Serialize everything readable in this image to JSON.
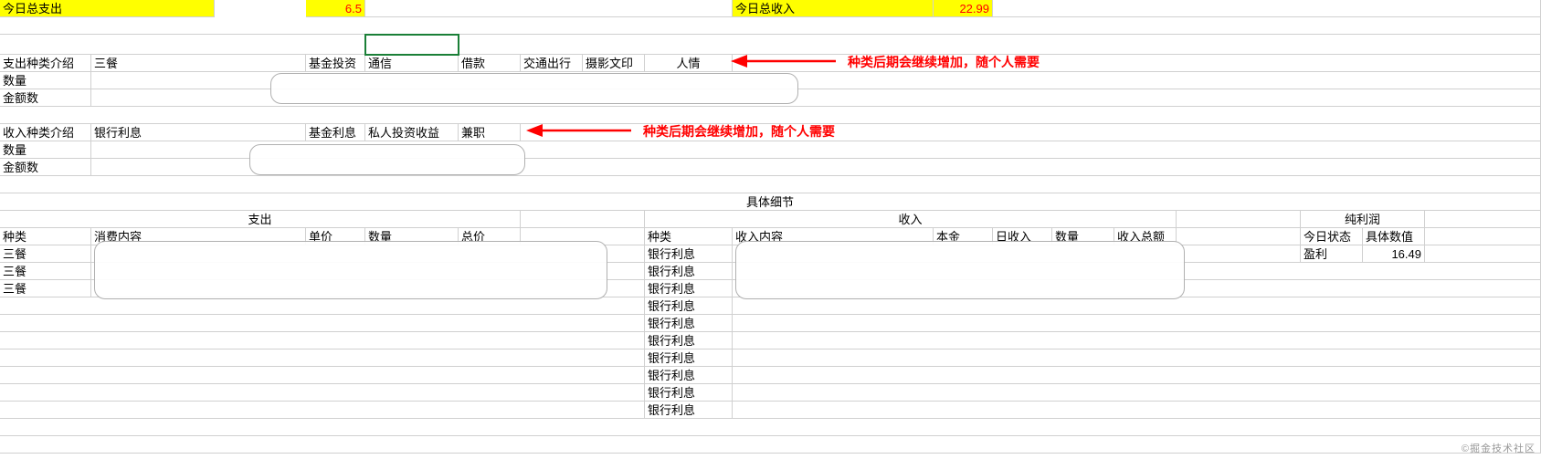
{
  "summary": {
    "expense_label": "今日总支出",
    "expense_value": "6.5",
    "income_label": "今日总收入",
    "income_value": "22.99"
  },
  "expense_category": {
    "row_label": "支出种类介绍",
    "items": [
      "三餐",
      "基金投资",
      "通信",
      "借款",
      "交通出行",
      "摄影文印",
      "人情"
    ],
    "qty_label": "数量",
    "amount_label": "金额数"
  },
  "income_category": {
    "row_label": "收入种类介绍",
    "items": [
      "银行利息",
      "基金利息",
      "私人投资收益",
      "兼职"
    ],
    "qty_label": "数量",
    "amount_label": "金额数"
  },
  "annotations": {
    "note1": "种类后期会继续增加，随个人需要",
    "note2": "种类后期会继续增加，随个人需要"
  },
  "details": {
    "section_title": "具体细节",
    "expense_header": "支出",
    "income_header": "收入",
    "profit_header": "纯利润",
    "expense_cols": [
      "种类",
      "消费内容",
      "单价",
      "数量",
      "总价"
    ],
    "income_cols": [
      "种类",
      "收入内容",
      "本金",
      "日收入",
      "数量",
      "收入总额"
    ],
    "profit_cols": [
      "今日状态",
      "具体数值"
    ],
    "expense_rows": [
      "三餐",
      "三餐",
      "三餐"
    ],
    "income_rows": [
      "银行利息",
      "银行利息",
      "银行利息",
      "银行利息",
      "银行利息",
      "银行利息",
      "银行利息",
      "银行利息",
      "银行利息",
      "银行利息"
    ],
    "profit_status": "盈利",
    "profit_value": "16.49"
  },
  "watermark": "©掘金技术社区",
  "chart_data": {
    "type": "table",
    "title": "日常收支记录表",
    "summary": {
      "今日总支出": 6.5,
      "今日总收入": 22.99,
      "今日状态": "盈利",
      "纯利润": 16.49
    },
    "支出种类": [
      "三餐",
      "基金投资",
      "通信",
      "借款",
      "交通出行",
      "摄影文印",
      "人情"
    ],
    "收入种类": [
      "银行利息",
      "基金利息",
      "私人投资收益",
      "兼职"
    ],
    "支出明细_种类列": [
      "三餐",
      "三餐",
      "三餐"
    ],
    "收入明细_种类列": [
      "银行利息",
      "银行利息",
      "银行利息",
      "银行利息",
      "银行利息",
      "银行利息",
      "银行利息",
      "银行利息",
      "银行利息",
      "银行利息"
    ]
  }
}
